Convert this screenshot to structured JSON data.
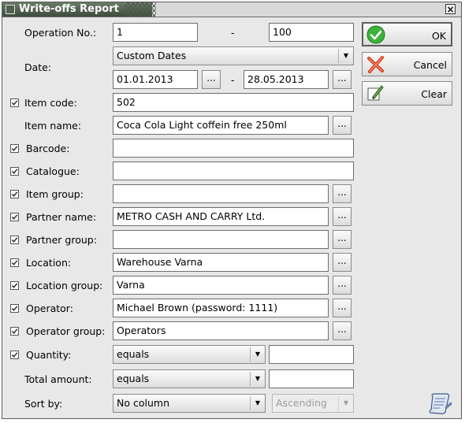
{
  "window": {
    "title": "Write-offs Report",
    "close_symbol": "×"
  },
  "fields": {
    "operation_no": {
      "label": "Operation No.:",
      "from": "1",
      "separator": "-",
      "to": "100"
    },
    "date": {
      "label": "Date:",
      "range_type": "Custom Dates",
      "from": "01.01.2013",
      "separator": "-",
      "to": "28.05.2013"
    },
    "item_code": {
      "label": "Item code:",
      "value": "502",
      "checked": true
    },
    "item_name": {
      "label": "Item name:",
      "value": "Coca Cola Light coffein free 250ml"
    },
    "barcode": {
      "label": "Barcode:",
      "value": "",
      "checked": true
    },
    "catalogue": {
      "label": "Catalogue:",
      "value": "",
      "checked": true
    },
    "item_group": {
      "label": "Item group:",
      "value": "",
      "checked": true
    },
    "partner_name": {
      "label": "Partner name:",
      "value": "METRO CASH AND CARRY Ltd.",
      "checked": true
    },
    "partner_group": {
      "label": "Partner group:",
      "value": "",
      "checked": true
    },
    "location": {
      "label": "Location:",
      "value": "Warehouse Varna",
      "checked": true
    },
    "location_group": {
      "label": "Location group:",
      "value": "Varna",
      "checked": true
    },
    "operator": {
      "label": "Operator:",
      "value": "Michael Brown (password: 1111)",
      "checked": true
    },
    "operator_group": {
      "label": "Operator group:",
      "value": "Operators",
      "checked": true
    },
    "quantity": {
      "label": "Quantity:",
      "condition": "equals",
      "value": "",
      "checked": true
    },
    "total_amount": {
      "label": "Total amount:",
      "condition": "equals",
      "value": ""
    },
    "sort_by": {
      "label": "Sort by:",
      "column": "No column",
      "order": "Ascending"
    }
  },
  "browse_label": "...",
  "dropdown_arrow": "▼",
  "buttons": {
    "ok": "OK",
    "cancel": "Cancel",
    "clear": "Clear"
  },
  "icons": {
    "ok": "green-check-icon",
    "cancel": "red-x-icon",
    "clear": "eraser-icon",
    "report": "scroll-icon",
    "window": "window-menu-icon",
    "checkbox": "checkmark-icon"
  },
  "colors": {
    "titlebar": "#4f5e4e",
    "ok_green": "#2aa02a",
    "cancel_red": "#d83a1a",
    "background": "#e8e8e8"
  }
}
